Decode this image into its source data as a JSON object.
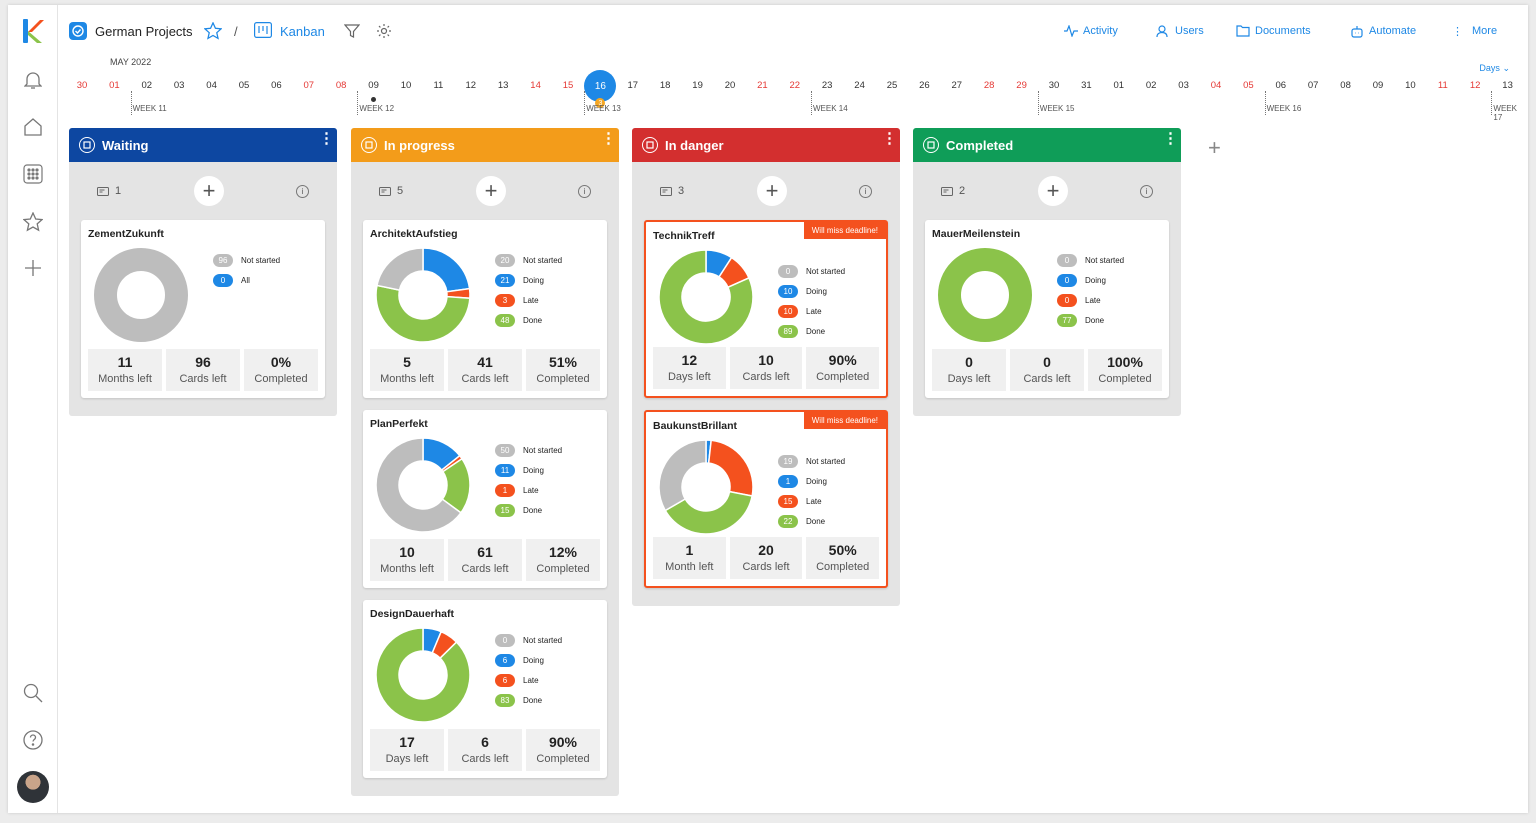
{
  "header": {
    "project": "German Projects",
    "separator": "/",
    "view": "Kanban",
    "nav": [
      "Activity",
      "Users",
      "Documents",
      "Automate",
      "More"
    ]
  },
  "timeline": {
    "month": "MAY 2022",
    "selector": "Days",
    "days": [
      {
        "d": "30",
        "we": true
      },
      {
        "d": "01",
        "we": true
      },
      {
        "d": "02"
      },
      {
        "d": "03"
      },
      {
        "d": "04"
      },
      {
        "d": "05"
      },
      {
        "d": "06"
      },
      {
        "d": "07",
        "we": true
      },
      {
        "d": "08",
        "we": true
      },
      {
        "d": "09"
      },
      {
        "d": "10"
      },
      {
        "d": "11"
      },
      {
        "d": "12"
      },
      {
        "d": "13"
      },
      {
        "d": "14",
        "we": true
      },
      {
        "d": "15",
        "we": true
      },
      {
        "d": "16"
      },
      {
        "d": "17"
      },
      {
        "d": "18"
      },
      {
        "d": "19"
      },
      {
        "d": "20"
      },
      {
        "d": "21",
        "we": true
      },
      {
        "d": "22",
        "we": true
      },
      {
        "d": "23"
      },
      {
        "d": "24"
      },
      {
        "d": "25"
      },
      {
        "d": "26"
      },
      {
        "d": "27"
      },
      {
        "d": "28",
        "we": true
      },
      {
        "d": "29",
        "we": true
      },
      {
        "d": "30"
      },
      {
        "d": "31"
      },
      {
        "d": "01"
      },
      {
        "d": "02"
      },
      {
        "d": "03"
      },
      {
        "d": "04",
        "we": true
      },
      {
        "d": "05",
        "we": true
      },
      {
        "d": "06"
      },
      {
        "d": "07"
      },
      {
        "d": "08"
      },
      {
        "d": "09"
      },
      {
        "d": "10"
      },
      {
        "d": "11",
        "we": true
      },
      {
        "d": "12",
        "we": true
      },
      {
        "d": "13"
      }
    ],
    "weeks": [
      "WEEK 11",
      "WEEK 12",
      "WEEK 13",
      "WEEK 14",
      "WEEK 15",
      "WEEK 16",
      "WEEK 17"
    ],
    "today": "16",
    "today_badge": "3"
  },
  "colors": {
    "not_started": "#bdbdbd",
    "doing": "#1e88e5",
    "late": "#f4511e",
    "done": "#8bc34a"
  },
  "legend_labels": {
    "not_started": "Not started",
    "doing": "Doing",
    "late": "Late",
    "done": "Done",
    "all": "All"
  },
  "deadline_text": "Will miss deadline!",
  "columns": [
    {
      "name": "Waiting",
      "color": "#0d47a1",
      "count": "1",
      "cards": [
        {
          "title": "ZementZukunft",
          "simple": true,
          "not_started": 96,
          "all": 0,
          "stats": [
            [
              "11",
              "Months left"
            ],
            [
              "96",
              "Cards left"
            ],
            [
              "0%",
              "Completed"
            ]
          ]
        }
      ]
    },
    {
      "name": "In progress",
      "color": "#f39c1a",
      "count": "5",
      "cards": [
        {
          "title": "ArchitektAufstieg",
          "not_started": 20,
          "doing": 21,
          "late": 3,
          "done": 48,
          "stats": [
            [
              "5",
              "Months left"
            ],
            [
              "41",
              "Cards left"
            ],
            [
              "51%",
              "Completed"
            ]
          ]
        },
        {
          "title": "PlanPerfekt",
          "not_started": 50,
          "doing": 11,
          "late": 1,
          "done": 15,
          "stats": [
            [
              "10",
              "Months left"
            ],
            [
              "61",
              "Cards left"
            ],
            [
              "12%",
              "Completed"
            ]
          ]
        },
        {
          "title": "DesignDauerhaft",
          "not_started": 0,
          "doing": 6,
          "late": 6,
          "done": 83,
          "stats": [
            [
              "17",
              "Days left"
            ],
            [
              "6",
              "Cards left"
            ],
            [
              "90%",
              "Completed"
            ]
          ]
        }
      ]
    },
    {
      "name": "In danger",
      "color": "#d32f2f",
      "count": "3",
      "cards": [
        {
          "title": "TechnikTreff",
          "danger": true,
          "not_started": 0,
          "doing": 10,
          "late": 10,
          "done": 89,
          "stats": [
            [
              "12",
              "Days left"
            ],
            [
              "10",
              "Cards left"
            ],
            [
              "90%",
              "Completed"
            ]
          ]
        },
        {
          "title": "BaukunstBrillant",
          "danger": true,
          "not_started": 19,
          "doing": 1,
          "late": 15,
          "done": 22,
          "stats": [
            [
              "1",
              "Month left"
            ],
            [
              "20",
              "Cards left"
            ],
            [
              "50%",
              "Completed"
            ]
          ]
        }
      ]
    },
    {
      "name": "Completed",
      "color": "#0f9d58",
      "count": "2",
      "cards": [
        {
          "title": "MauerMeilenstein",
          "not_started": 0,
          "doing": 0,
          "late": 0,
          "done": 77,
          "stats": [
            [
              "0",
              "Days left"
            ],
            [
              "0",
              "Cards left"
            ],
            [
              "100%",
              "Completed"
            ]
          ]
        }
      ]
    }
  ]
}
